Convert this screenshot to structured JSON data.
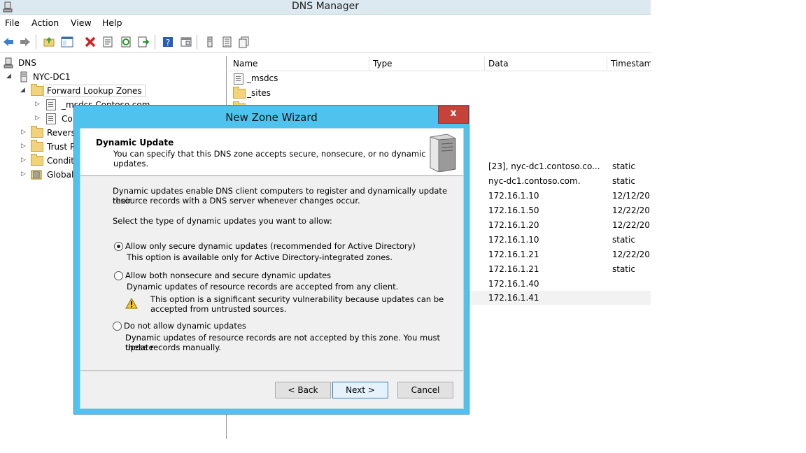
{
  "window": {
    "title": "DNS Manager"
  },
  "menu": [
    "File",
    "Action",
    "View",
    "Help"
  ],
  "toolbar": {
    "icons": [
      "back-arrow-icon",
      "forward-arrow-icon",
      "up-folder-icon",
      "show-tree-icon",
      "delete-icon",
      "properties-icon",
      "refresh-icon",
      "export-icon",
      "help-icon",
      "console-icon",
      "server-icon",
      "list-icon",
      "zone-icon"
    ]
  },
  "tree": {
    "nodes": [
      {
        "label": "DNS"
      },
      {
        "label": "NYC-DC1"
      },
      {
        "label": "Forward Lookup Zones"
      },
      {
        "label": "_msdcs.Contoso.com"
      },
      {
        "label": "Co"
      },
      {
        "label": "Revers"
      },
      {
        "label": "Trust P"
      },
      {
        "label": "Condit"
      },
      {
        "label": "Global"
      }
    ]
  },
  "list": {
    "columns": [
      "Name",
      "Type",
      "Data",
      "Timestam"
    ],
    "rows": [
      {
        "name": "_msdcs",
        "type": "",
        "data": "",
        "timestamp": ""
      },
      {
        "name": "_sites",
        "type": "",
        "data": "",
        "timestamp": ""
      },
      {
        "name": "",
        "type": "",
        "data": "[23], nyc-dc1.contoso.co...",
        "timestamp": "static"
      },
      {
        "name": "",
        "type": "",
        "data": "nyc-dc1.contoso.com.",
        "timestamp": "static"
      },
      {
        "name": "",
        "type": "",
        "data": "172.16.1.10",
        "timestamp": "12/12/201"
      },
      {
        "name": "",
        "type": "",
        "data": "172.16.1.50",
        "timestamp": "12/22/201"
      },
      {
        "name": "",
        "type": "",
        "data": "172.16.1.20",
        "timestamp": "12/22/201"
      },
      {
        "name": "",
        "type": "",
        "data": "172.16.1.10",
        "timestamp": "static"
      },
      {
        "name": "",
        "type": "",
        "data": "172.16.1.21",
        "timestamp": "12/22/201"
      },
      {
        "name": "",
        "type": "",
        "data": "172.16.1.21",
        "timestamp": "static"
      },
      {
        "name": "",
        "type": "",
        "data": "172.16.1.40",
        "timestamp": ""
      },
      {
        "name": "",
        "type": "",
        "data": "172.16.1.41",
        "timestamp": ""
      }
    ]
  },
  "wizard": {
    "title": "New Zone Wizard",
    "close": "x",
    "header_title": "Dynamic Update",
    "header_desc_1": "You can specify that this DNS zone accepts secure, nonsecure, or no dynamic",
    "header_desc_2": "updates.",
    "intro_1": "Dynamic updates enable DNS client computers to register and dynamically update their",
    "intro_2": "resource records with a DNS server whenever changes occur.",
    "select_prompt": "Select the type of dynamic updates you want to allow:",
    "options": [
      {
        "label": "Allow only secure dynamic updates (recommended for Active Directory)",
        "desc_1": "This option is available only for Active Directory-integrated zones.",
        "desc_2": "",
        "selected": true
      },
      {
        "label": "Allow both nonsecure and secure dynamic updates",
        "desc_1": "Dynamic updates of resource records are accepted from any client.",
        "desc_2": "",
        "selected": false
      },
      {
        "label": "Do not allow dynamic updates",
        "desc_1": "Dynamic updates of resource records are not accepted by this zone. You must update",
        "desc_2": "these records manually.",
        "selected": false
      }
    ],
    "warning_1": "This option is a significant security vulnerability because updates can be",
    "warning_2": "accepted from untrusted sources.",
    "buttons": {
      "back": "< Back",
      "next": "Next >",
      "cancel": "Cancel"
    }
  },
  "colors": {
    "dialog_frame": "#4fc2ee",
    "close_button": "#c6423a",
    "title_bar": "#dde9f0"
  }
}
